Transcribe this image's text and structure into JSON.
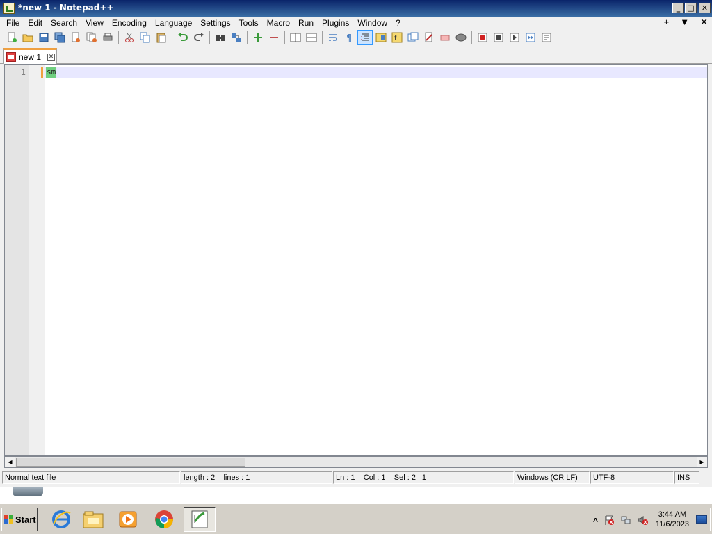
{
  "window": {
    "title": "*new 1 - Notepad++",
    "controls": {
      "minimize": "_",
      "maximize": "□",
      "close": "✕"
    }
  },
  "menu": {
    "items": [
      "File",
      "Edit",
      "Search",
      "View",
      "Encoding",
      "Language",
      "Settings",
      "Tools",
      "Macro",
      "Run",
      "Plugins",
      "Window",
      "?"
    ],
    "right": {
      "add": "+",
      "dropdown": "▼",
      "close": "✕"
    }
  },
  "toolbar": {
    "icons": [
      "new-file-icon",
      "open-file-icon",
      "save-icon",
      "save-all-icon",
      "close-icon",
      "close-all-icon",
      "print-icon",
      "cut-icon",
      "copy-icon",
      "paste-icon",
      "undo-icon",
      "redo-icon",
      "find-icon",
      "replace-icon",
      "zoom-in-icon",
      "zoom-out-icon",
      "sync-vertical-icon",
      "sync-horizontal-icon",
      "word-wrap-icon",
      "show-all-chars-icon",
      "indent-guide-icon",
      "document-map-icon",
      "function-list-icon",
      "folder-workspace-icon",
      "monitoring-icon",
      "record-macro-icon",
      "stop-macro-icon",
      "play-macro-icon",
      "run-macro-multiple-icon",
      "save-macro-icon"
    ]
  },
  "tabs": [
    {
      "label": "new 1",
      "close": "✕"
    }
  ],
  "editor": {
    "lines": [
      {
        "number": "1",
        "text": "sm"
      }
    ]
  },
  "statusbar": {
    "file_type": "Normal text file",
    "length_lines": "length : 2    lines : 1",
    "position": "Ln : 1    Col : 1    Sel : 2 | 1",
    "eol": "Windows (CR LF)",
    "encoding": "UTF-8",
    "mode": "INS"
  },
  "taskbar": {
    "start_label": "Start",
    "time": "3:44 AM",
    "date": "11/6/2023",
    "tray_expand": "˄"
  },
  "colors": {
    "accent": "#f0a040",
    "selection": "#6fcf7f",
    "current_line": "#e8e8ff"
  }
}
